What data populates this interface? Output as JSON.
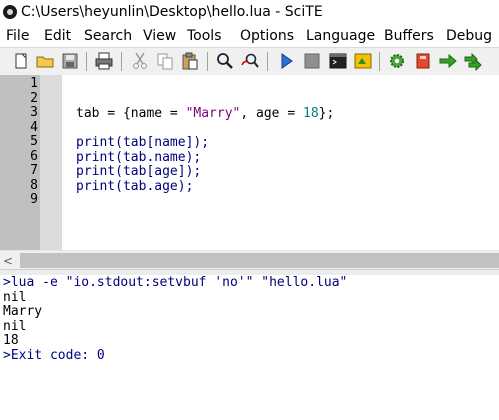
{
  "window": {
    "title": "C:\\Users\\heyunlin\\Desktop\\hello.lua - SciTE",
    "icon": "scite-app-icon"
  },
  "menu": {
    "items": [
      {
        "label": "File"
      },
      {
        "label": "Edit"
      },
      {
        "label": "Search"
      },
      {
        "label": "View"
      },
      {
        "label": "Tools"
      },
      {
        "label": "Options"
      },
      {
        "label": "Language"
      },
      {
        "label": "Buffers"
      },
      {
        "label": "Debug"
      }
    ]
  },
  "toolbar": {
    "buttons": [
      {
        "icon": "new-file-icon"
      },
      {
        "icon": "open-folder-icon"
      },
      {
        "icon": "save-icon"
      },
      {
        "icon": "print-icon"
      },
      {
        "icon": "cut-icon"
      },
      {
        "icon": "copy-icon"
      },
      {
        "icon": "paste-icon"
      },
      {
        "icon": "find-icon"
      },
      {
        "icon": "replace-icon"
      },
      {
        "icon": "run-icon"
      },
      {
        "icon": "stop-icon"
      },
      {
        "icon": "console-icon"
      },
      {
        "icon": "build-icon"
      },
      {
        "icon": "settings-icon"
      },
      {
        "icon": "bookmark-icon"
      },
      {
        "icon": "go-icon"
      },
      {
        "icon": "step-icon"
      }
    ]
  },
  "editor": {
    "line_numbers": [
      "1",
      "2",
      "3",
      "4",
      "5",
      "6",
      "7",
      "8",
      "9"
    ],
    "lines": [
      [],
      [],
      [
        {
          "t": "tab = {name = ",
          "c": "default"
        },
        {
          "t": "\"Marry\"",
          "c": "string"
        },
        {
          "t": ", age = ",
          "c": "default"
        },
        {
          "t": "18",
          "c": "number"
        },
        {
          "t": "};",
          "c": "default"
        }
      ],
      [],
      [
        {
          "t": "print(tab[name]);",
          "c": "keyword"
        }
      ],
      [
        {
          "t": "print(tab.name);",
          "c": "keyword"
        }
      ],
      [
        {
          "t": "print(tab[age]);",
          "c": "keyword"
        }
      ],
      [
        {
          "t": "print(tab.age);",
          "c": "keyword"
        }
      ],
      []
    ]
  },
  "output": {
    "lines": [
      {
        "text": ">lua -e \"io.stdout:setvbuf 'no'\" \"hello.lua\"",
        "kind": "cmd"
      },
      {
        "text": "nil",
        "kind": "text"
      },
      {
        "text": "Marry",
        "kind": "text"
      },
      {
        "text": "nil",
        "kind": "text"
      },
      {
        "text": "18",
        "kind": "text"
      },
      {
        "text": ">Exit code: 0",
        "kind": "cmd"
      }
    ]
  },
  "colors": {
    "keyword": "#00007f",
    "string": "#7f007f",
    "number": "#007f7f",
    "gutter": "#c0c0c0"
  }
}
